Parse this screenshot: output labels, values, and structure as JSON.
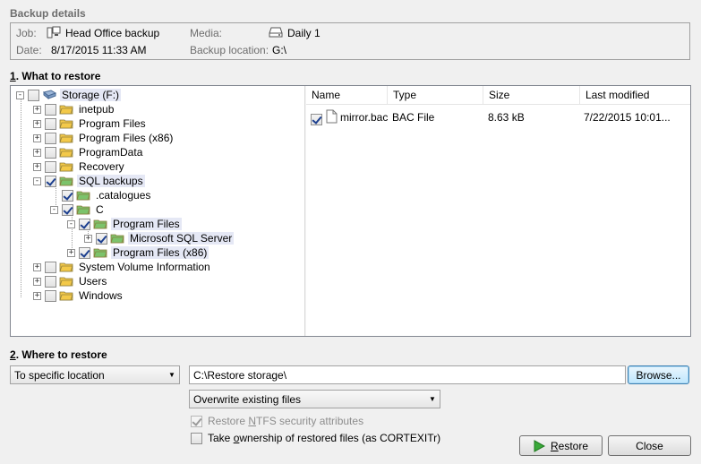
{
  "backup_details": {
    "title": "Backup details",
    "job_label": "Job:",
    "job_value": "Head Office backup",
    "date_label": "Date:",
    "date_value": "8/17/2015 11:33 AM",
    "media_label": "Media:",
    "media_value": "Daily 1",
    "location_label": "Backup location:",
    "location_value": "G:\\"
  },
  "what_to_restore": {
    "title_num": "1",
    "title_rest": ". What to restore",
    "tree": [
      {
        "label": "Storage (F:)",
        "checked": false,
        "expander": "-",
        "icon": "drive"
      },
      {
        "label": "inetpub",
        "checked": false,
        "expander": "+",
        "icon": "folder"
      },
      {
        "label": "Program Files",
        "checked": false,
        "expander": "+",
        "icon": "folder"
      },
      {
        "label": "Program Files (x86)",
        "checked": false,
        "expander": "+",
        "icon": "folder"
      },
      {
        "label": "ProgramData",
        "checked": false,
        "expander": "+",
        "icon": "folder"
      },
      {
        "label": "Recovery",
        "checked": false,
        "expander": "+",
        "icon": "folder"
      },
      {
        "label": "SQL backups",
        "checked": true,
        "expander": "-",
        "icon": "folder-green"
      },
      {
        "label": ".catalogues",
        "checked": true,
        "expander": "",
        "icon": "folder-green"
      },
      {
        "label": "C",
        "checked": true,
        "expander": "-",
        "icon": "folder-green"
      },
      {
        "label": "Program Files",
        "checked": true,
        "expander": "-",
        "icon": "folder-green"
      },
      {
        "label": "Microsoft SQL Server",
        "checked": true,
        "expander": "+",
        "icon": "folder-green"
      },
      {
        "label": "Program Files (x86)",
        "checked": true,
        "expander": "+",
        "icon": "folder-green"
      },
      {
        "label": "System Volume Information",
        "checked": false,
        "expander": "+",
        "icon": "folder"
      },
      {
        "label": "Users",
        "checked": false,
        "expander": "+",
        "icon": "folder"
      },
      {
        "label": "Windows",
        "checked": false,
        "expander": "+",
        "icon": "folder"
      }
    ],
    "columns": [
      "Name",
      "Type",
      "Size",
      "Last modified"
    ],
    "files": [
      {
        "name": "mirror.bac",
        "type": "BAC File",
        "size": "8.63 kB",
        "modified": "7/22/2015 10:01...",
        "checked": true
      }
    ]
  },
  "where_to_restore": {
    "title_num": "2",
    "title_rest": ". Where to restore",
    "location_mode": "To specific location",
    "path": "C:\\Restore storage\\",
    "browse_label": "Browse...",
    "overwrite_mode": "Overwrite existing files",
    "ntfs_pre": "Restore ",
    "ntfs_key": "N",
    "ntfs_post": "TFS security attributes",
    "ntfs_checked": true,
    "ownership_pre": "Take ",
    "ownership_key": "o",
    "ownership_post": "wnership of restored files (as CORTEXITr)",
    "ownership_checked": false
  },
  "buttons": {
    "restore_key": "R",
    "restore_rest": "estore",
    "close_label": "Close"
  },
  "colors": {
    "folder_yellow": "#f3c949",
    "folder_green": "#7cc36b",
    "restore_arrow": "#3aa93a"
  }
}
